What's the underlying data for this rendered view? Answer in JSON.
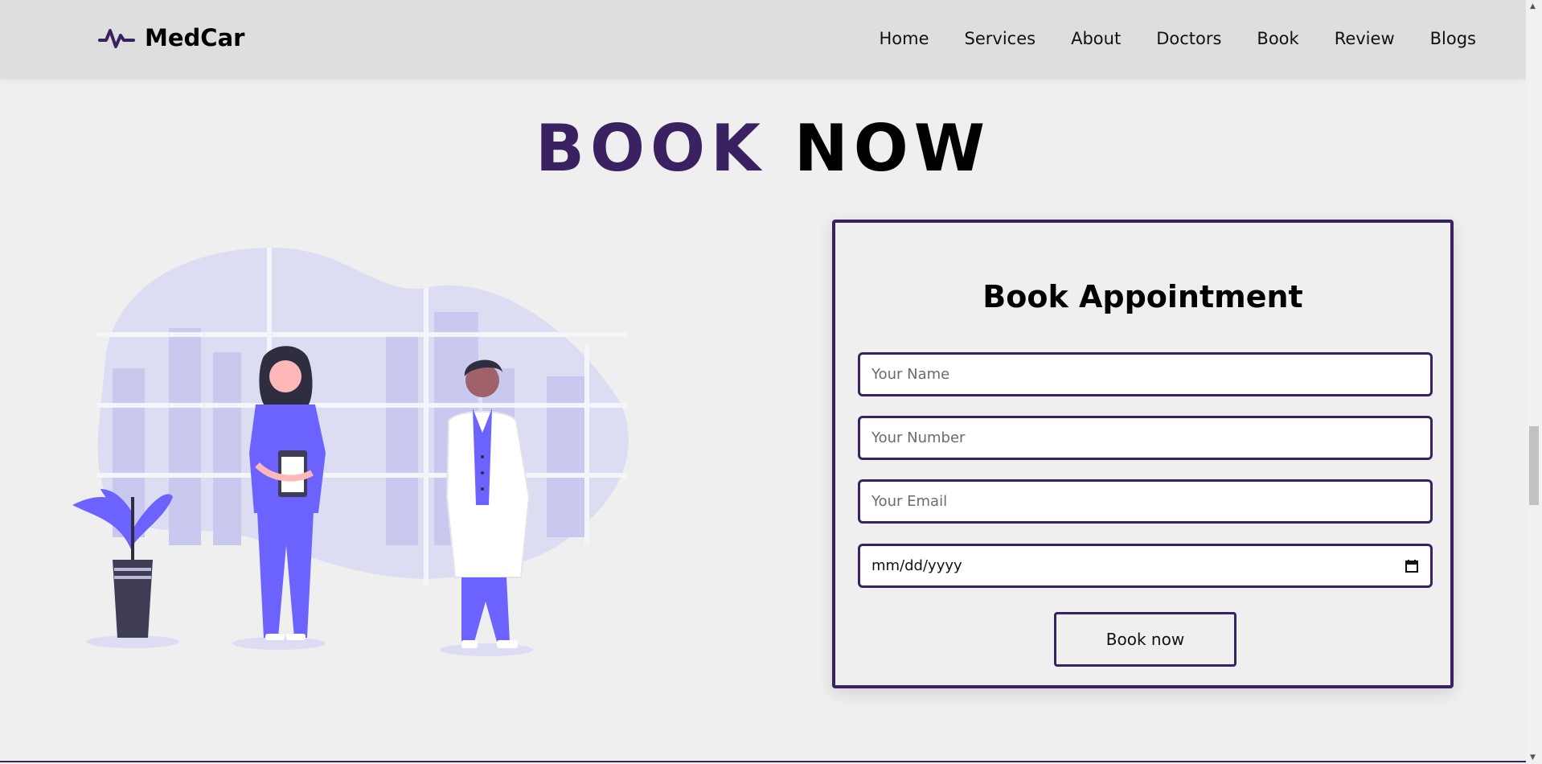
{
  "brand": {
    "name": "MedCar"
  },
  "nav": [
    "Home",
    "Services",
    "About",
    "Doctors",
    "Book",
    "Review",
    "Blogs"
  ],
  "section": {
    "heading_part1": "BOOK",
    "heading_part2": "NOW"
  },
  "form": {
    "title": "Book Appointment",
    "name_placeholder": "Your Name",
    "number_placeholder": "Your Number",
    "email_placeholder": "Your Email",
    "date_placeholder": "mm/dd/yyyy",
    "submit_label": "Book now"
  },
  "colors": {
    "accent": "#3a2161",
    "illustration": "#6c63ff",
    "background": "#efefef",
    "header": "#dedede"
  },
  "icons": {
    "logo": "heartbeat-icon",
    "date": "calendar-icon"
  }
}
